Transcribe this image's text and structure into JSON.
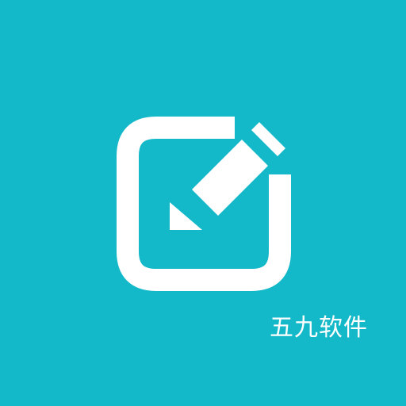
{
  "app": {
    "icon_name": "edit-note-icon",
    "caption": "五九软件"
  },
  "colors": {
    "background": "#14b9c9",
    "foreground": "#ffffff"
  }
}
